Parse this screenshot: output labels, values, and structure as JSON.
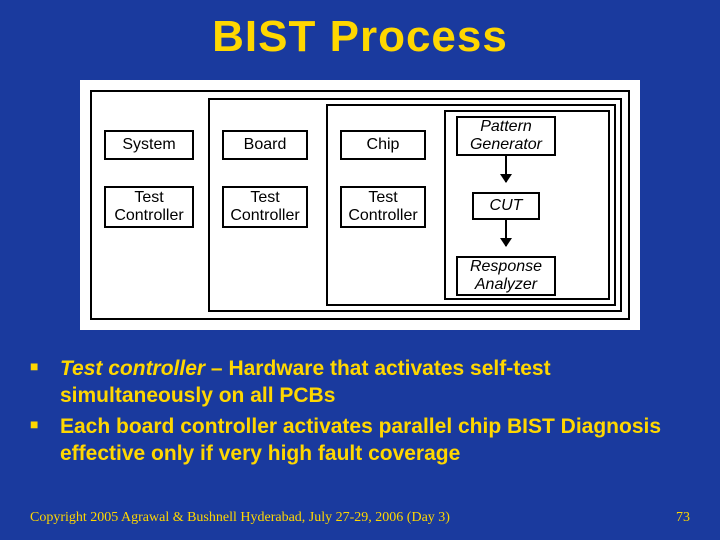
{
  "title": "BIST Process",
  "diagram": {
    "system": "System",
    "board": "Board",
    "chip": "Chip",
    "pattern_gen": "Pattern Generator",
    "tc1": "Test Controller",
    "tc2": "Test Controller",
    "tc3": "Test Controller",
    "cut": "CUT",
    "response": "Response Analyzer"
  },
  "bullets": [
    {
      "lead": "Test controller",
      "rest": " – Hardware that activates self-test simultaneously on all PCBs"
    },
    {
      "lead": "",
      "rest": "Each board controller activates parallel chip BIST Diagnosis effective only if very high fault coverage"
    }
  ],
  "footer": {
    "left": "Copyright 2005 Agrawal & Bushnell   Hyderabad, July 27-29, 2006 (Day 3)",
    "right": "73"
  }
}
